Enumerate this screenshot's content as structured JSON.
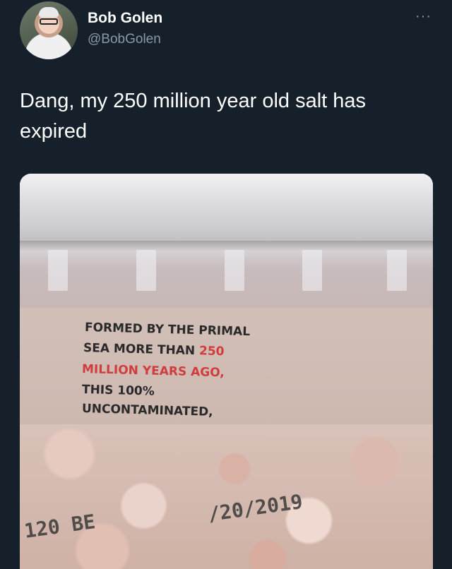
{
  "author": {
    "name": "Bob Golen",
    "handle": "@BobGolen",
    "avatar_icon": "profile-avatar"
  },
  "menu": {
    "more_label": "···"
  },
  "tweet": {
    "text": "Dang, my 250 million year old salt has expired"
  },
  "media": {
    "label_lines": [
      {
        "text": "FORMED BY THE PRIMAL"
      },
      {
        "text_plain": "SEA MORE THAN ",
        "text_red": "250"
      },
      {
        "text_red": "MILLION YEARS AGO,"
      },
      {
        "text": "THIS 100%"
      },
      {
        "text": "UNCONTAMINATED,"
      }
    ],
    "stamp_left": "120 BE",
    "stamp_right": "/20/2019"
  },
  "colors": {
    "background": "#15202b",
    "text": "#ffffff",
    "secondary_text": "#8b98a5",
    "label_red": "#d13c3c"
  }
}
